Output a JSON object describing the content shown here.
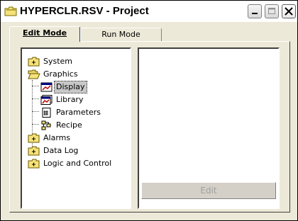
{
  "window": {
    "title": "HYPERCLR.RSV - Project"
  },
  "tabs": [
    {
      "label": "Edit Mode",
      "active": true
    },
    {
      "label": "Run Mode",
      "active": false
    }
  ],
  "tree": {
    "items": [
      {
        "label": "System",
        "icon": "folder-closed-icon"
      },
      {
        "label": "Graphics",
        "icon": "folder-open-icon"
      },
      {
        "label": "Display",
        "icon": "display-icon",
        "selected": true
      },
      {
        "label": "Library",
        "icon": "library-icon"
      },
      {
        "label": "Parameters",
        "icon": "parameters-icon"
      },
      {
        "label": "Recipe",
        "icon": "recipe-icon"
      },
      {
        "label": "Alarms",
        "icon": "folder-closed-icon"
      },
      {
        "label": "Data Log",
        "icon": "folder-closed-icon"
      },
      {
        "label": "Logic and Control",
        "icon": "folder-closed-icon"
      }
    ]
  },
  "detail": {
    "edit_label": "Edit"
  }
}
